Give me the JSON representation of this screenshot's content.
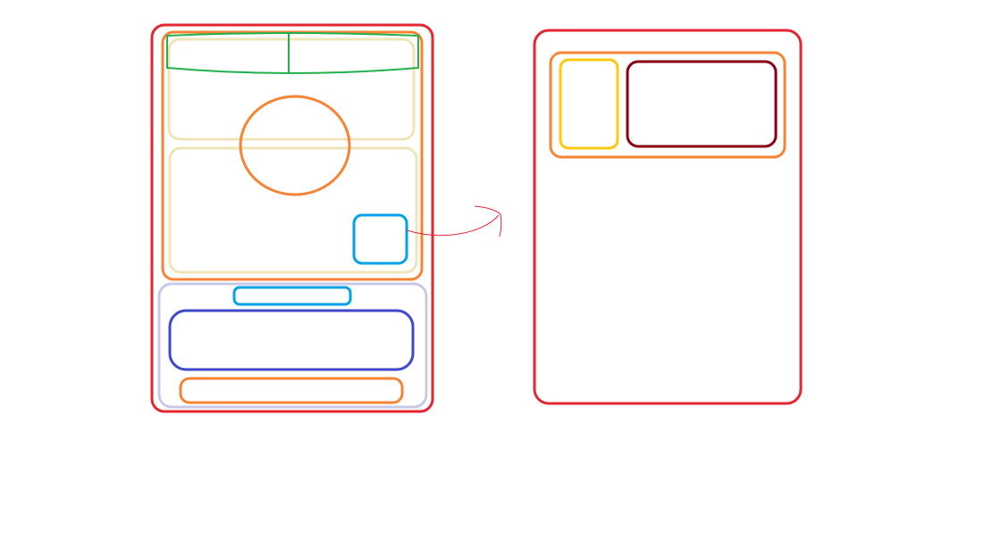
{
  "colors": {
    "red": "#e32630",
    "orange": "#f78434",
    "beige": "#efe4b8",
    "green": "#22b14c",
    "cyan": "#00a2e8",
    "lavender": "#c8c8e8",
    "blue": "#3f48cc",
    "yellow": "#ffc90e",
    "maroon": "#880015"
  },
  "diagram": {
    "left_panel": {
      "label": "",
      "items": [
        "outer-frame",
        "top-card",
        "top-bar-left",
        "top-bar-right",
        "upper-section",
        "lower-section",
        "circle",
        "small-square",
        "bottom-card",
        "pill",
        "wide-box",
        "footer-bar"
      ]
    },
    "connector": {
      "label": ""
    },
    "right_panel": {
      "label": "",
      "items": [
        "outer-frame",
        "header-row",
        "yellow-box",
        "maroon-box"
      ]
    }
  }
}
